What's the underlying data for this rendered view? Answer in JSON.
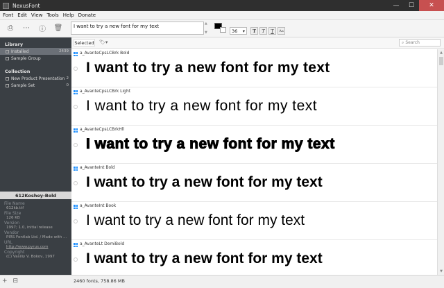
{
  "window": {
    "title": "NexusFont",
    "minimize": "—",
    "maximize": "☐",
    "close": "✕"
  },
  "menu": [
    "Font",
    "Edit",
    "View",
    "Tools",
    "Help",
    "Donate"
  ],
  "toolbar": {
    "preview_text": "I want to try a new font for my text",
    "font_size": "36",
    "style_buttons": [
      "T",
      "T",
      "T",
      "Aa"
    ]
  },
  "sidebar": {
    "library_header": "Library",
    "library_items": [
      {
        "label": "Installed",
        "count": "2439"
      },
      {
        "label": "Sample Group",
        "count": ""
      }
    ],
    "collection_header": "Collection",
    "collection_items": [
      {
        "label": "New Product Presentation",
        "count": "2"
      },
      {
        "label": "Sample Set",
        "count": "0"
      }
    ]
  },
  "info": {
    "title": "612Koshey-Bold",
    "fields": [
      {
        "key": "File Name",
        "value": "612kb.ttf"
      },
      {
        "key": "File Size",
        "value": "126 KB"
      },
      {
        "key": "Version",
        "value": "1997; 1.0, initial release"
      },
      {
        "key": "Vendor",
        "value": "PIRS Fontlab Ltd. / Made with ..."
      },
      {
        "key": "URL",
        "value": "http://www.pyrus.com"
      },
      {
        "key": "Copyright",
        "value": "(C) Vasiliy V. Bokov, 1997"
      }
    ]
  },
  "filter": {
    "selected_label": "Selected",
    "search_placeholder": "Search"
  },
  "fonts": [
    {
      "name": "a_AvanteCpsLCBrk Bold",
      "sample": "I want to try a new font for my text"
    },
    {
      "name": "a_AvanteCpsLCBrk Light",
      "sample": "I want to try a new font for my text"
    },
    {
      "name": "a_AvanteCpsLCBrkHll",
      "sample": "I want to try a new font for my text"
    },
    {
      "name": "a_AvanteInt Bold",
      "sample": "I want to try a new font for my text"
    },
    {
      "name": "a_AvanteInt Book",
      "sample": "I want to try a new font for my text"
    },
    {
      "name": "a_AvanteLt DemiBold",
      "sample": "I want to try a new font for my text"
    }
  ],
  "status": {
    "text": "2460 fonts, 758.86 MB"
  }
}
